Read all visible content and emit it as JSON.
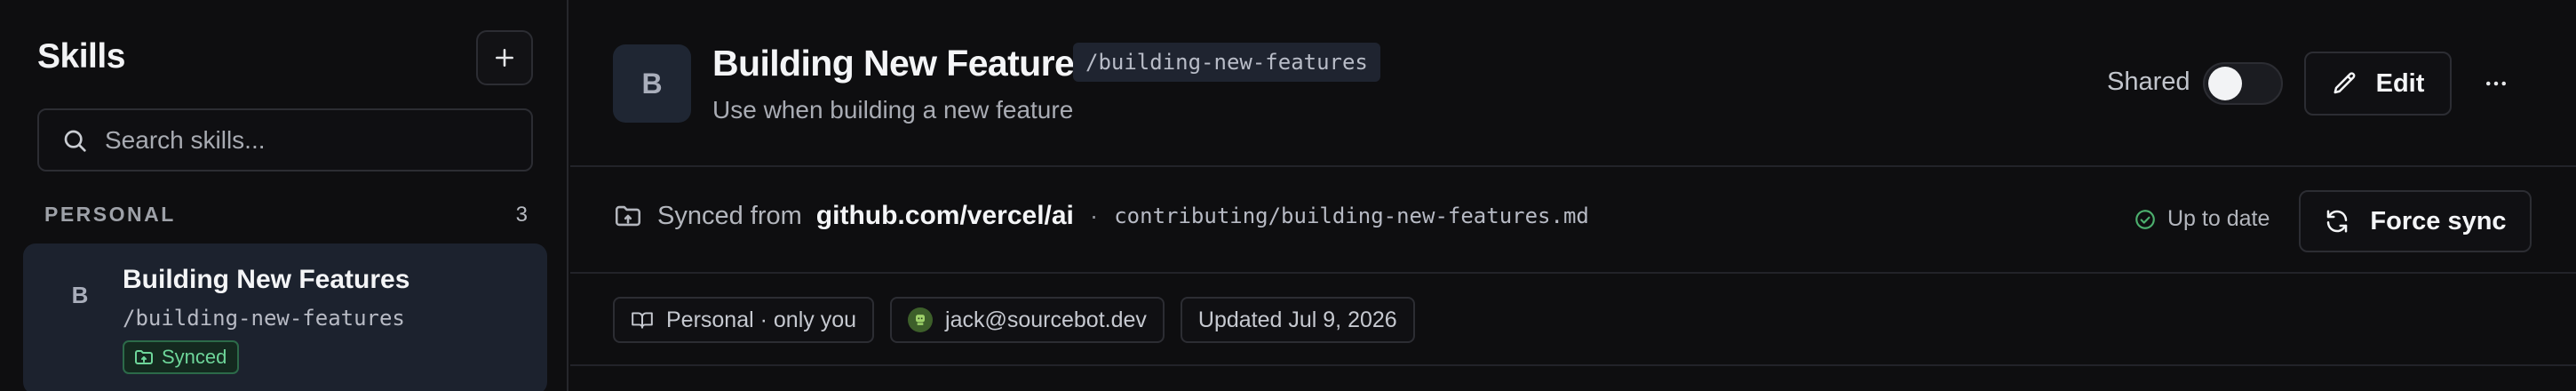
{
  "sidebar": {
    "title": "Skills",
    "add_icon": "plus-icon",
    "search": {
      "placeholder": "Search skills...",
      "icon": "search-icon"
    },
    "section": {
      "label": "PERSONAL",
      "count": "3"
    },
    "items": [
      {
        "avatar_letter": "B",
        "name": "Building New Features",
        "slug": "/building-new-features",
        "badge": "Synced",
        "badge_icon": "folder-sync-icon",
        "selected": true
      }
    ]
  },
  "header": {
    "avatar_letter": "B",
    "title": "Building New Features",
    "slug": "/building-new-features",
    "description": "Use when building a new feature",
    "shared_label": "Shared",
    "shared_on": false,
    "edit_label": "Edit",
    "edit_icon": "pencil-icon",
    "more_icon": "more-horizontal-icon"
  },
  "sync": {
    "icon": "folder-sync-icon",
    "prefix": "Synced from",
    "repo": "github.com/vercel/ai",
    "separator": "·",
    "path": "contributing/building-new-features.md",
    "status_icon": "check-circle-icon",
    "status": "Up to date",
    "force_label": "Force sync",
    "force_icon": "refresh-icon"
  },
  "meta": {
    "visibility": "Personal · only you",
    "visibility_icon": "book-open-icon",
    "owner": "jack@sourcebot.dev",
    "owner_icon": "avatar",
    "updated": "Updated Jul 9, 2026"
  },
  "colors": {
    "background": "#0e0e10",
    "selected_item": "#1c222e",
    "synced_green": "#6ed69a",
    "border": "#2c2d33"
  }
}
